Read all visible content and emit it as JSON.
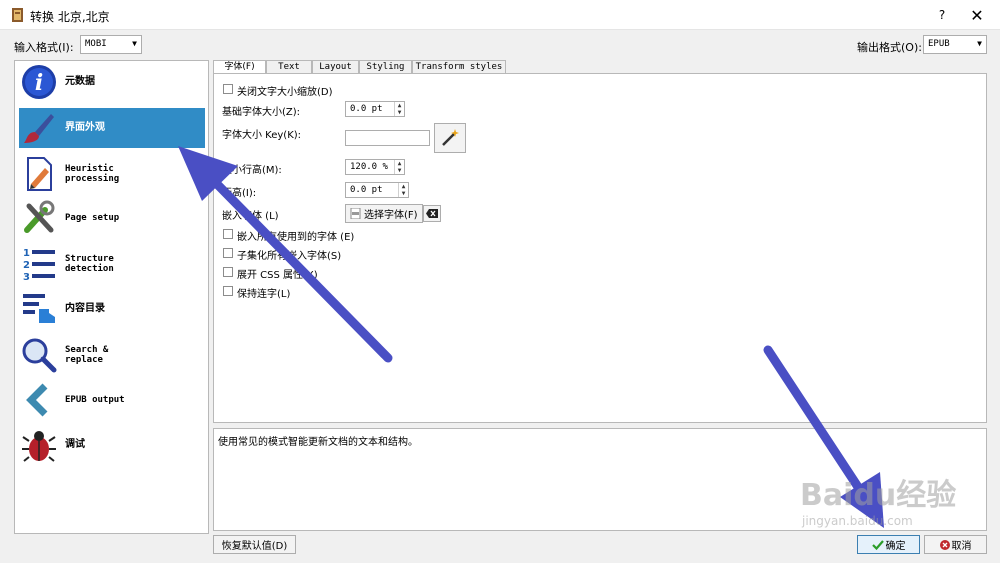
{
  "window": {
    "title": "转换 北京,北京",
    "help_label": "?",
    "close_label": "✕"
  },
  "input_format": {
    "label": "输入格式(I):",
    "value": "MOBI"
  },
  "output_format": {
    "label": "输出格式(O):",
    "value": "EPUB"
  },
  "sidebar": {
    "items": [
      {
        "label": "元数据",
        "icon": "info-icon"
      },
      {
        "label": "界面外观",
        "icon": "brush-icon",
        "selected": true
      },
      {
        "label": "Heuristic\nprocessing",
        "icon": "document-edit-icon"
      },
      {
        "label": "Page setup",
        "icon": "tools-icon"
      },
      {
        "label": "Structure\ndetection",
        "icon": "numbered-list-icon"
      },
      {
        "label": "内容目录",
        "icon": "toc-icon"
      },
      {
        "label": "Search &\nreplace",
        "icon": "magnifier-icon"
      },
      {
        "label": "EPUB output",
        "icon": "chevron-left-icon"
      },
      {
        "label": "调试",
        "icon": "bug-icon"
      }
    ]
  },
  "tabs": [
    {
      "label": "字体(F)",
      "active": true
    },
    {
      "label": "Text"
    },
    {
      "label": "Layout"
    },
    {
      "label": "Styling"
    },
    {
      "label": "Transform styles"
    }
  ],
  "form": {
    "disable_font_rescaling": "关闭文字大小缩放(D)",
    "base_font_size_label": "基础字体大小(Z):",
    "base_font_size_value": "0.0 pt",
    "font_size_key_label": "字体大小 Key(K):",
    "font_size_key_value": "",
    "min_line_height_label": "最小行高(M):",
    "min_line_height_value": "120.0 %",
    "line_height_label": "行高(I):",
    "line_height_value": "0.0 pt",
    "embed_font_label": "嵌入字体 (L)",
    "choose_font_label": "选择字体(F)",
    "embed_all_fonts": "嵌入所有使用到的字体 (E)",
    "subset_fonts": "子集化所有嵌入字体(S)",
    "expand_css": "展开 CSS 属性(X)",
    "keep_ligatures": "保持连字(L)"
  },
  "description": "使用常见的模式智能更新文档的文本和结构。",
  "buttons": {
    "restore_defaults": "恢复默认值(D)",
    "ok": "确定",
    "cancel": "取消"
  },
  "watermark": {
    "brand": "Baidu经验",
    "url": "jingyan.baidu.com"
  },
  "colors": {
    "selection": "#308cc6",
    "arrow": "#4a4fc4",
    "ok_check": "#2a9d2a",
    "cancel_x": "#c0282d"
  }
}
